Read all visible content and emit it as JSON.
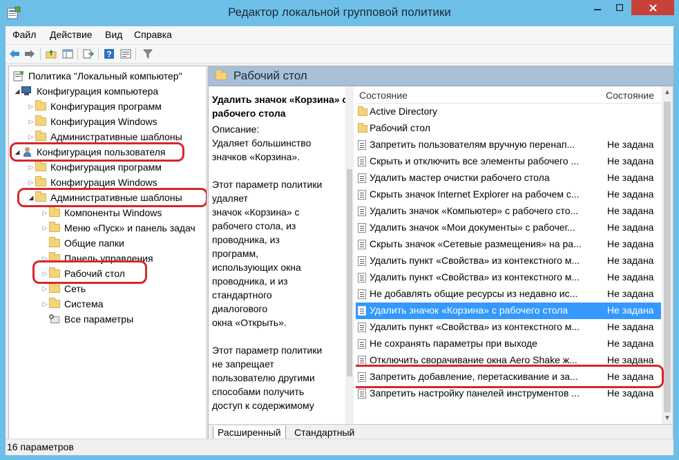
{
  "window": {
    "title": "Редактор локальной групповой политики"
  },
  "menu": [
    "Файл",
    "Действие",
    "Вид",
    "Справка"
  ],
  "tree": {
    "root": "Политика \"Локальный компьютер\"",
    "computer_config": "Конфигурация компьютера",
    "computer_children": [
      "Конфигурация программ",
      "Конфигурация Windows",
      "Административные шаблоны"
    ],
    "user_config": "Конфигурация пользователя",
    "user_children": [
      "Конфигурация программ",
      "Конфигурация Windows"
    ],
    "admin_templates": "Административные шаблоны",
    "admin_children": [
      "Компоненты Windows",
      "Меню «Пуск» и панель задач",
      "Общие папки",
      "Панель управления"
    ],
    "desktop": "Рабочий стол",
    "network": "Сеть",
    "system": "Система",
    "all_settings": "Все параметры"
  },
  "header": {
    "title": "Рабочий стол"
  },
  "description": {
    "title": "Удалить значок «Корзина» с рабочего стола",
    "label": "Описание:",
    "lines": [
      "Удаляет большинство",
      "значков «Корзина».",
      "",
      "Этот параметр политики",
      "удаляет",
      "значок «Корзина» с",
      "рабочего стола, из",
      "проводника, из",
      "программ,",
      "использующих окна",
      "проводника, и из",
      "стандартного",
      "диалогового",
      "окна «Открыть».",
      "",
      "Этот параметр политики",
      "не запрещает",
      "пользователю другими",
      "способами получить",
      "доступ к содержимому"
    ]
  },
  "list": {
    "col_name": "Состояние",
    "col_state": "Состояние",
    "rows": [
      {
        "type": "folder",
        "name": "Active Directory",
        "state": ""
      },
      {
        "type": "folder",
        "name": "Рабочий стол",
        "state": ""
      },
      {
        "type": "policy",
        "name": "Запретить пользователям вручную перенап...",
        "state": "Не задана"
      },
      {
        "type": "policy",
        "name": "Скрыть и отключить все элементы рабочего ...",
        "state": "Не задана"
      },
      {
        "type": "policy",
        "name": "Удалить мастер очистки рабочего стола",
        "state": "Не задана"
      },
      {
        "type": "policy",
        "name": "Скрыть значок Internet Explorer на рабочем с...",
        "state": "Не задана"
      },
      {
        "type": "policy",
        "name": "Удалить значок «Компьютер» с рабочего сто...",
        "state": "Не задана"
      },
      {
        "type": "policy",
        "name": "Удалить значок «Мои документы» с рабочег...",
        "state": "Не задана"
      },
      {
        "type": "policy",
        "name": "Скрыть значок «Сетевые размещения» на ра...",
        "state": "Не задана"
      },
      {
        "type": "policy",
        "name": "Удалить пункт «Свойства» из контекстного м...",
        "state": "Не задана"
      },
      {
        "type": "policy",
        "name": "Удалить пункт «Свойства» из контекстного м...",
        "state": "Не задана"
      },
      {
        "type": "policy",
        "name": "Не добавлять общие ресурсы из недавно ис...",
        "state": "Не задана"
      },
      {
        "type": "policy",
        "name": "Удалить значок «Корзина» с рабочего стола",
        "state": "Не задана",
        "selected": true
      },
      {
        "type": "policy",
        "name": "Удалить пункт «Свойства» из контекстного м...",
        "state": "Не задана"
      },
      {
        "type": "policy",
        "name": "Не сохранять параметры при выходе",
        "state": "Не задана"
      },
      {
        "type": "policy",
        "name": "Отключить сворачивание окна Aero Shake ж...",
        "state": "Не задана"
      },
      {
        "type": "policy",
        "name": "Запретить добавление, перетаскивание и за...",
        "state": "Не задана"
      },
      {
        "type": "policy",
        "name": "Запретить настройку панелей инструментов ...",
        "state": "Не задана"
      }
    ]
  },
  "tabs": [
    "Расширенный",
    "Стандартный"
  ],
  "status": {
    "text": "16 параметров"
  },
  "colors": {
    "selection": "#3399ff",
    "highlight_ring": "#d6262b",
    "header_band": "#a8bfd6"
  }
}
